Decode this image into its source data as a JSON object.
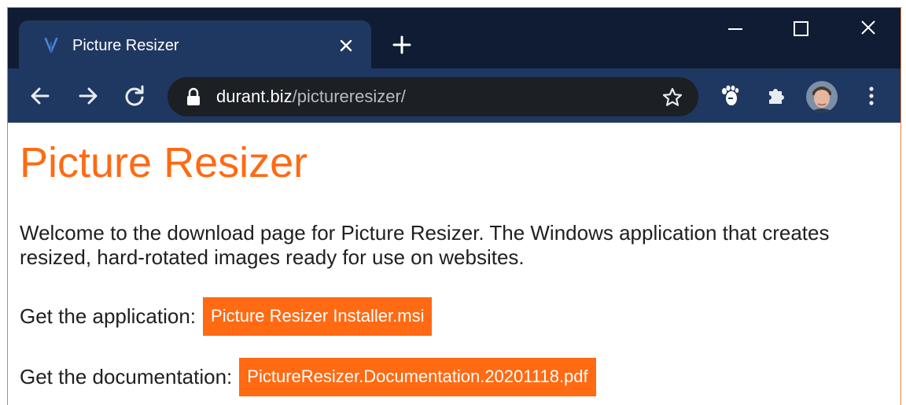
{
  "browser": {
    "tab": {
      "title": "Picture Resizer",
      "favicon": "picture-resizer-favicon"
    },
    "address_bar": {
      "host": "durant.biz",
      "path": "/pictureresizer/"
    },
    "icons": {
      "back": "arrow-left-icon",
      "forward": "arrow-right-icon",
      "reload": "reload-icon",
      "lock": "lock-icon",
      "bookmark": "star-icon",
      "extension_1": "paw-icon",
      "extensions": "puzzle-icon",
      "menu": "kebab-menu-icon"
    },
    "colors": {
      "titlebar": "#0f1c33",
      "toolbar": "#1f3861",
      "omnibox": "#1c1f24"
    }
  },
  "page": {
    "title": "Picture Resizer",
    "intro": "Welcome to the download page for Picture Resizer. The Windows application that creates resized, hard-rotated images ready for use on websites.",
    "downloads": [
      {
        "label": "Get the application:",
        "link_text": "Picture Resizer Installer.msi"
      },
      {
        "label": "Get the documentation:",
        "link_text": "PictureResizer.Documentation.20201118.pdf"
      }
    ],
    "colors": {
      "accent": "#ff6a13",
      "text": "#1f1f1f"
    }
  }
}
